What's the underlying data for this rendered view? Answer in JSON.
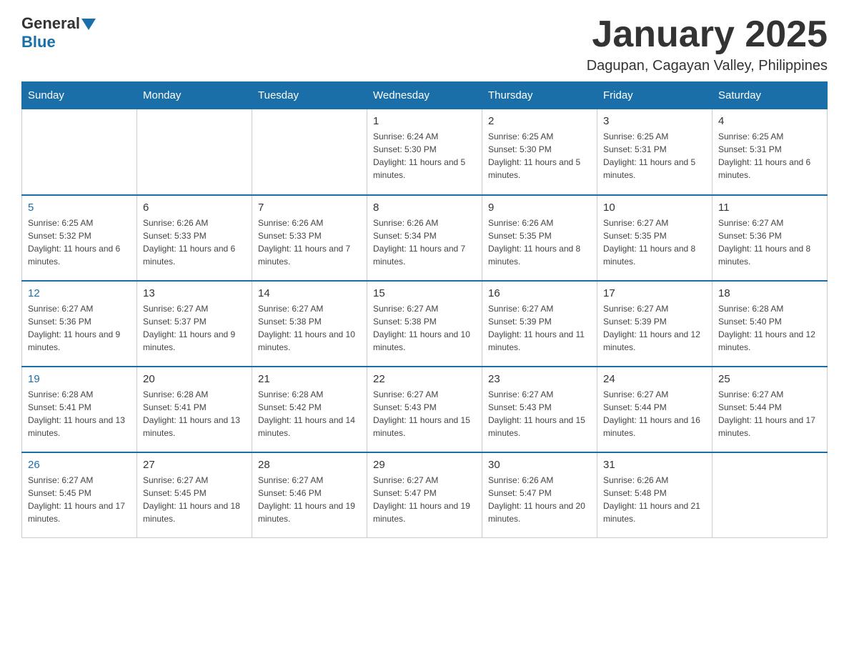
{
  "header": {
    "logo_general": "General",
    "logo_blue": "Blue",
    "title": "January 2025",
    "subtitle": "Dagupan, Cagayan Valley, Philippines"
  },
  "days_of_week": [
    "Sunday",
    "Monday",
    "Tuesday",
    "Wednesday",
    "Thursday",
    "Friday",
    "Saturday"
  ],
  "weeks": [
    [
      {
        "day": "",
        "info": ""
      },
      {
        "day": "",
        "info": ""
      },
      {
        "day": "",
        "info": ""
      },
      {
        "day": "1",
        "info": "Sunrise: 6:24 AM\nSunset: 5:30 PM\nDaylight: 11 hours and 5 minutes."
      },
      {
        "day": "2",
        "info": "Sunrise: 6:25 AM\nSunset: 5:30 PM\nDaylight: 11 hours and 5 minutes."
      },
      {
        "day": "3",
        "info": "Sunrise: 6:25 AM\nSunset: 5:31 PM\nDaylight: 11 hours and 5 minutes."
      },
      {
        "day": "4",
        "info": "Sunrise: 6:25 AM\nSunset: 5:31 PM\nDaylight: 11 hours and 6 minutes."
      }
    ],
    [
      {
        "day": "5",
        "info": "Sunrise: 6:25 AM\nSunset: 5:32 PM\nDaylight: 11 hours and 6 minutes."
      },
      {
        "day": "6",
        "info": "Sunrise: 6:26 AM\nSunset: 5:33 PM\nDaylight: 11 hours and 6 minutes."
      },
      {
        "day": "7",
        "info": "Sunrise: 6:26 AM\nSunset: 5:33 PM\nDaylight: 11 hours and 7 minutes."
      },
      {
        "day": "8",
        "info": "Sunrise: 6:26 AM\nSunset: 5:34 PM\nDaylight: 11 hours and 7 minutes."
      },
      {
        "day": "9",
        "info": "Sunrise: 6:26 AM\nSunset: 5:35 PM\nDaylight: 11 hours and 8 minutes."
      },
      {
        "day": "10",
        "info": "Sunrise: 6:27 AM\nSunset: 5:35 PM\nDaylight: 11 hours and 8 minutes."
      },
      {
        "day": "11",
        "info": "Sunrise: 6:27 AM\nSunset: 5:36 PM\nDaylight: 11 hours and 8 minutes."
      }
    ],
    [
      {
        "day": "12",
        "info": "Sunrise: 6:27 AM\nSunset: 5:36 PM\nDaylight: 11 hours and 9 minutes."
      },
      {
        "day": "13",
        "info": "Sunrise: 6:27 AM\nSunset: 5:37 PM\nDaylight: 11 hours and 9 minutes."
      },
      {
        "day": "14",
        "info": "Sunrise: 6:27 AM\nSunset: 5:38 PM\nDaylight: 11 hours and 10 minutes."
      },
      {
        "day": "15",
        "info": "Sunrise: 6:27 AM\nSunset: 5:38 PM\nDaylight: 11 hours and 10 minutes."
      },
      {
        "day": "16",
        "info": "Sunrise: 6:27 AM\nSunset: 5:39 PM\nDaylight: 11 hours and 11 minutes."
      },
      {
        "day": "17",
        "info": "Sunrise: 6:27 AM\nSunset: 5:39 PM\nDaylight: 11 hours and 12 minutes."
      },
      {
        "day": "18",
        "info": "Sunrise: 6:28 AM\nSunset: 5:40 PM\nDaylight: 11 hours and 12 minutes."
      }
    ],
    [
      {
        "day": "19",
        "info": "Sunrise: 6:28 AM\nSunset: 5:41 PM\nDaylight: 11 hours and 13 minutes."
      },
      {
        "day": "20",
        "info": "Sunrise: 6:28 AM\nSunset: 5:41 PM\nDaylight: 11 hours and 13 minutes."
      },
      {
        "day": "21",
        "info": "Sunrise: 6:28 AM\nSunset: 5:42 PM\nDaylight: 11 hours and 14 minutes."
      },
      {
        "day": "22",
        "info": "Sunrise: 6:27 AM\nSunset: 5:43 PM\nDaylight: 11 hours and 15 minutes."
      },
      {
        "day": "23",
        "info": "Sunrise: 6:27 AM\nSunset: 5:43 PM\nDaylight: 11 hours and 15 minutes."
      },
      {
        "day": "24",
        "info": "Sunrise: 6:27 AM\nSunset: 5:44 PM\nDaylight: 11 hours and 16 minutes."
      },
      {
        "day": "25",
        "info": "Sunrise: 6:27 AM\nSunset: 5:44 PM\nDaylight: 11 hours and 17 minutes."
      }
    ],
    [
      {
        "day": "26",
        "info": "Sunrise: 6:27 AM\nSunset: 5:45 PM\nDaylight: 11 hours and 17 minutes."
      },
      {
        "day": "27",
        "info": "Sunrise: 6:27 AM\nSunset: 5:45 PM\nDaylight: 11 hours and 18 minutes."
      },
      {
        "day": "28",
        "info": "Sunrise: 6:27 AM\nSunset: 5:46 PM\nDaylight: 11 hours and 19 minutes."
      },
      {
        "day": "29",
        "info": "Sunrise: 6:27 AM\nSunset: 5:47 PM\nDaylight: 11 hours and 19 minutes."
      },
      {
        "day": "30",
        "info": "Sunrise: 6:26 AM\nSunset: 5:47 PM\nDaylight: 11 hours and 20 minutes."
      },
      {
        "day": "31",
        "info": "Sunrise: 6:26 AM\nSunset: 5:48 PM\nDaylight: 11 hours and 21 minutes."
      },
      {
        "day": "",
        "info": ""
      }
    ]
  ]
}
